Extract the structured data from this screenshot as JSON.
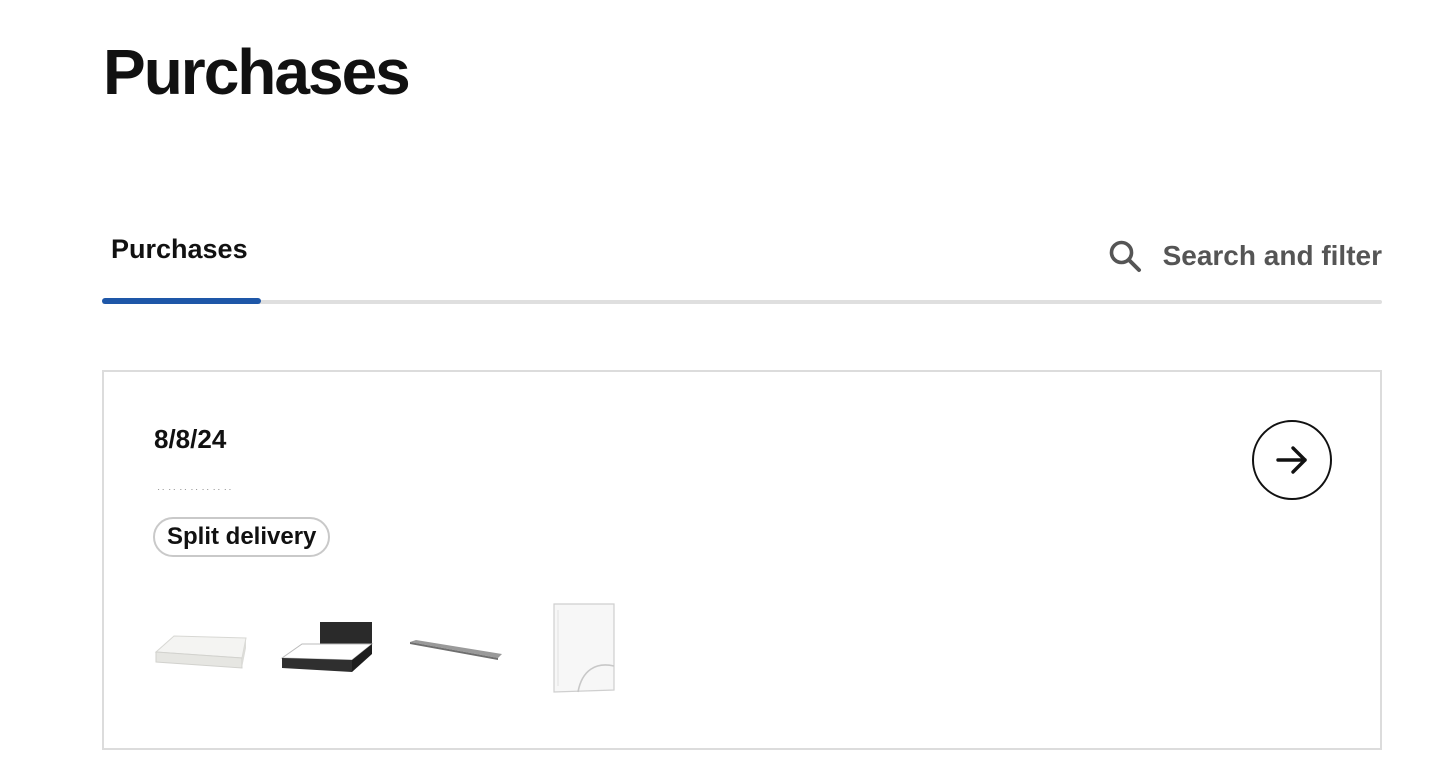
{
  "header": {
    "title": "Purchases"
  },
  "tabs": [
    {
      "label": "Purchases",
      "active": true
    }
  ],
  "search": {
    "label": "Search and filter",
    "icon": "search-icon"
  },
  "colors": {
    "accent": "#1e57a8",
    "text": "#111111",
    "muted": "#555555",
    "border": "#dcdcdc"
  },
  "orders": [
    {
      "date": "8/8/24",
      "order_number": "#######",
      "badge": "Split delivery",
      "open_icon": "arrow-right-icon",
      "items": [
        {
          "icon": "mattress-icon"
        },
        {
          "icon": "bed-frame-icon"
        },
        {
          "icon": "slatted-base-icon"
        },
        {
          "icon": "fitted-sheet-icon"
        }
      ]
    }
  ]
}
